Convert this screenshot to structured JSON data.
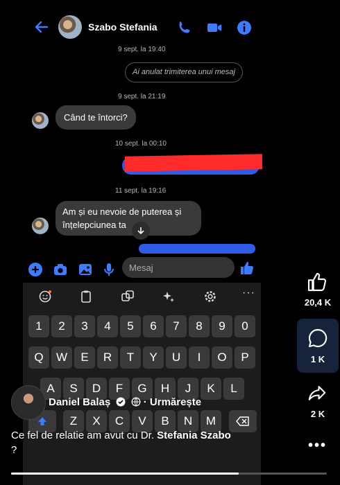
{
  "header": {
    "contact_name": "Szabo Stefania"
  },
  "chat": {
    "timestamp_1": "9 sept. la 19:40",
    "unsent_text": "Ai anulat trimiterea unui mesaj",
    "timestamp_2": "9 sept. la 21:19",
    "msg_1": "Când te întorci?",
    "timestamp_3": "10 sept. la 00:10",
    "timestamp_4": "11 sept. la 19:16",
    "msg_2_line1": "Am și eu nevoie de puterea și",
    "msg_2_line2": "înțelepciunea ta"
  },
  "composer": {
    "placeholder": "Mesaj"
  },
  "keyboard": {
    "row_numbers": [
      "1",
      "2",
      "3",
      "4",
      "5",
      "6",
      "7",
      "8",
      "9",
      "0"
    ],
    "row_qwerty": [
      "Q",
      "W",
      "E",
      "R",
      "T",
      "Y",
      "U",
      "I",
      "O",
      "P"
    ],
    "row_asdf": [
      "A",
      "S",
      "D",
      "F",
      "G",
      "H",
      "J",
      "K",
      "L"
    ],
    "row_zxcv": [
      "Z",
      "X",
      "C",
      "V",
      "B",
      "N",
      "M"
    ]
  },
  "rail": {
    "likes": "20,4 K",
    "comments": "1 K",
    "shares": "2 K"
  },
  "post": {
    "author": "Daniel Balaș",
    "follow": "· Urmărește",
    "caption_prefix": "Ce fel de relatie am avut cu Dr. ",
    "caption_bold": "Stefania Szabo",
    "caption_suffix": "?",
    "more": "•••"
  },
  "video_progress": 0.72,
  "colors": {
    "accent": "#2f6bff",
    "redaction": "#ff2b2b"
  }
}
